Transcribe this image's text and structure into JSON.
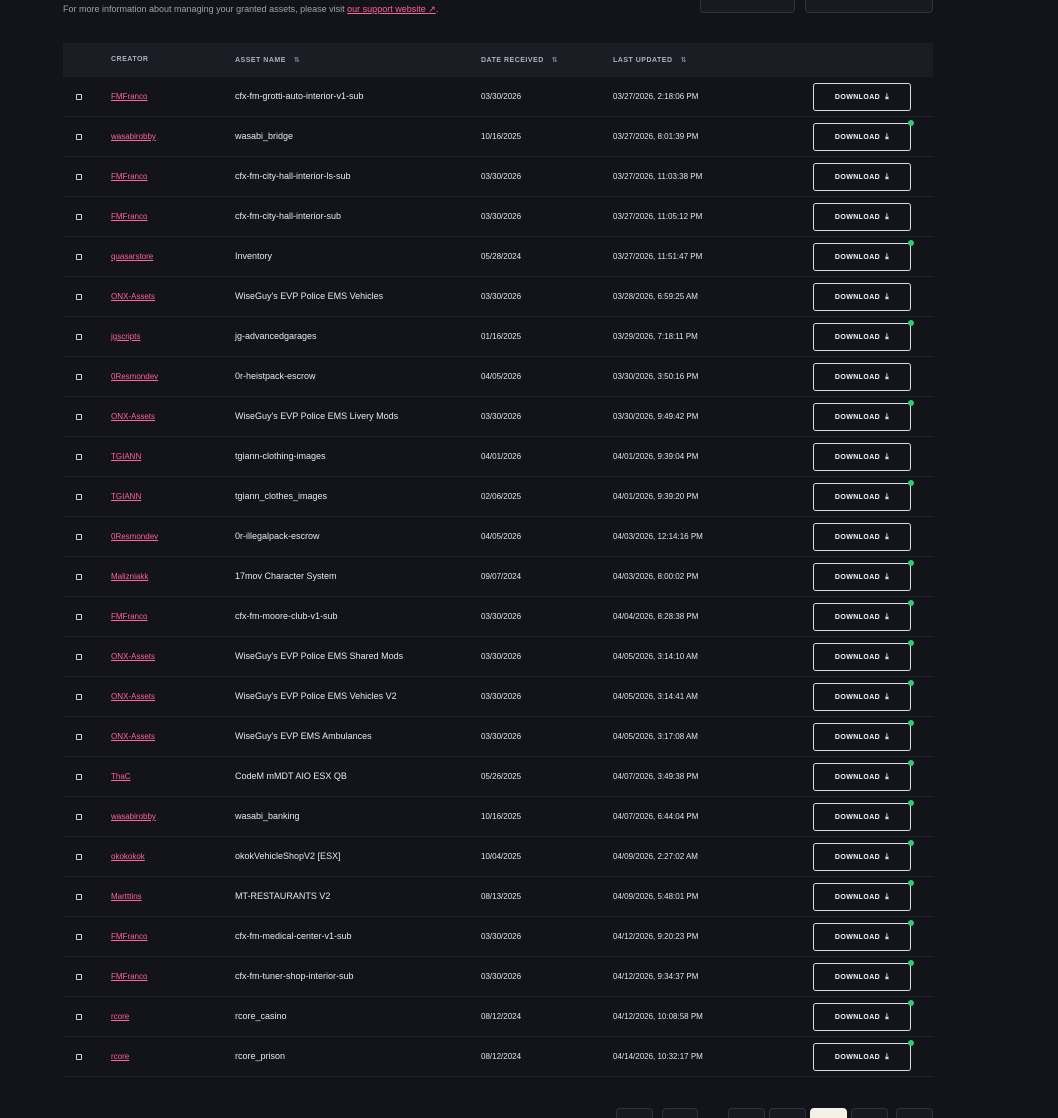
{
  "info": {
    "text": "For more information about managing your granted assets, please visit",
    "link_text": "our support website",
    "link_icon": "↗",
    "suffix": "."
  },
  "columns": {
    "creator": "CREATOR",
    "asset_name": "ASSET NAME",
    "date_received": "DATE RECEIVED",
    "last_updated": "LAST UPDATED",
    "sort_icon": "⇅"
  },
  "download_label": "DOWNLOAD",
  "download_icon": "⤓",
  "rows": [
    {
      "creator": "FMFranco",
      "asset": "cfx-fm-grotti-auto-interior-v1-sub",
      "received": "03/30/2026",
      "updated": "03/27/2026, 2:18:06 PM",
      "dot": false
    },
    {
      "creator": "wasabirobby",
      "asset": "wasabi_bridge",
      "received": "10/16/2025",
      "updated": "03/27/2026, 8:01:39 PM",
      "dot": true
    },
    {
      "creator": "FMFranco",
      "asset": "cfx-fm-city-hall-interior-ls-sub",
      "received": "03/30/2026",
      "updated": "03/27/2026, 11:03:38 PM",
      "dot": false
    },
    {
      "creator": "FMFranco",
      "asset": "cfx-fm-city-hall-interior-sub",
      "received": "03/30/2026",
      "updated": "03/27/2026, 11:05:12 PM",
      "dot": false
    },
    {
      "creator": "quasarstore",
      "asset": "Inventory",
      "received": "05/28/2024",
      "updated": "03/27/2026, 11:51:47 PM",
      "dot": true
    },
    {
      "creator": "ONX-Assets",
      "asset": "WiseGuy's EVP Police EMS Vehicles",
      "received": "03/30/2026",
      "updated": "03/28/2026, 6:59:25 AM",
      "dot": false
    },
    {
      "creator": "jgscripts",
      "asset": "jg-advancedgarages",
      "received": "01/16/2025",
      "updated": "03/29/2026, 7:18:11 PM",
      "dot": true
    },
    {
      "creator": "0Resmondev",
      "asset": "0r-heistpack-escrow",
      "received": "04/05/2026",
      "updated": "03/30/2026, 3:50:16 PM",
      "dot": false
    },
    {
      "creator": "ONX-Assets",
      "asset": "WiseGuy's EVP Police EMS Livery Mods",
      "received": "03/30/2026",
      "updated": "03/30/2026, 9:49:42 PM",
      "dot": true
    },
    {
      "creator": "TGIANN",
      "asset": "tgiann-clothing-images",
      "received": "04/01/2026",
      "updated": "04/01/2026, 9:39:04 PM",
      "dot": false
    },
    {
      "creator": "TGIANN",
      "asset": "tgiann_clothes_images",
      "received": "02/06/2025",
      "updated": "04/01/2026, 9:39:20 PM",
      "dot": true
    },
    {
      "creator": "0Resmondev",
      "asset": "0r-illegalpack-escrow",
      "received": "04/05/2026",
      "updated": "04/03/2026, 12:14:16 PM",
      "dot": false
    },
    {
      "creator": "Malizniakk",
      "asset": "17mov Character System",
      "received": "09/07/2024",
      "updated": "04/03/2026, 8:00:02 PM",
      "dot": true
    },
    {
      "creator": "FMFranco",
      "asset": "cfx-fm-moore-club-v1-sub",
      "received": "03/30/2026",
      "updated": "04/04/2026, 8:28:38 PM",
      "dot": true
    },
    {
      "creator": "ONX-Assets",
      "asset": "WiseGuy's EVP Police EMS Shared Mods",
      "received": "03/30/2026",
      "updated": "04/05/2026, 3:14:10 AM",
      "dot": true
    },
    {
      "creator": "ONX-Assets",
      "asset": "WiseGuy's EVP Police EMS Vehicles V2",
      "received": "03/30/2026",
      "updated": "04/05/2026, 3:14:41 AM",
      "dot": true
    },
    {
      "creator": "ONX-Assets",
      "asset": "WiseGuy's EVP EMS Ambulances",
      "received": "03/30/2026",
      "updated": "04/05/2026, 3:17:08 AM",
      "dot": true
    },
    {
      "creator": "ThaC",
      "asset": "CodeM mMDT AIO ESX QB",
      "received": "05/26/2025",
      "updated": "04/07/2026, 3:49:38 PM",
      "dot": true
    },
    {
      "creator": "wasabirobby",
      "asset": "wasabi_banking",
      "received": "10/16/2025",
      "updated": "04/07/2026, 6:44:04 PM",
      "dot": true
    },
    {
      "creator": "okokokok",
      "asset": "okokVehicleShopV2 [ESX]",
      "received": "10/04/2025",
      "updated": "04/09/2026, 2:27:02 AM",
      "dot": true
    },
    {
      "creator": "Martttins",
      "asset": "MT-RESTAURANTS V2",
      "received": "08/13/2025",
      "updated": "04/09/2026, 5:48:01 PM",
      "dot": true
    },
    {
      "creator": "FMFranco",
      "asset": "cfx-fm-medical-center-v1-sub",
      "received": "03/30/2026",
      "updated": "04/12/2026, 9:20:23 PM",
      "dot": true
    },
    {
      "creator": "FMFranco",
      "asset": "cfx-fm-tuner-shop-interior-sub",
      "received": "03/30/2026",
      "updated": "04/12/2026, 9:34:37 PM",
      "dot": true
    },
    {
      "creator": "rcore",
      "asset": "rcore_casino",
      "received": "08/12/2024",
      "updated": "04/12/2026, 10:08:58 PM",
      "dot": true
    },
    {
      "creator": "rcore",
      "asset": "rcore_prison",
      "received": "08/12/2024",
      "updated": "04/14/2026, 10:32:17 PM",
      "dot": true
    }
  ],
  "colors": {
    "background": "#12141a",
    "link": "#ff5fa3",
    "status_dot": "#2ecc71",
    "active_page": "#f4f1e6"
  }
}
